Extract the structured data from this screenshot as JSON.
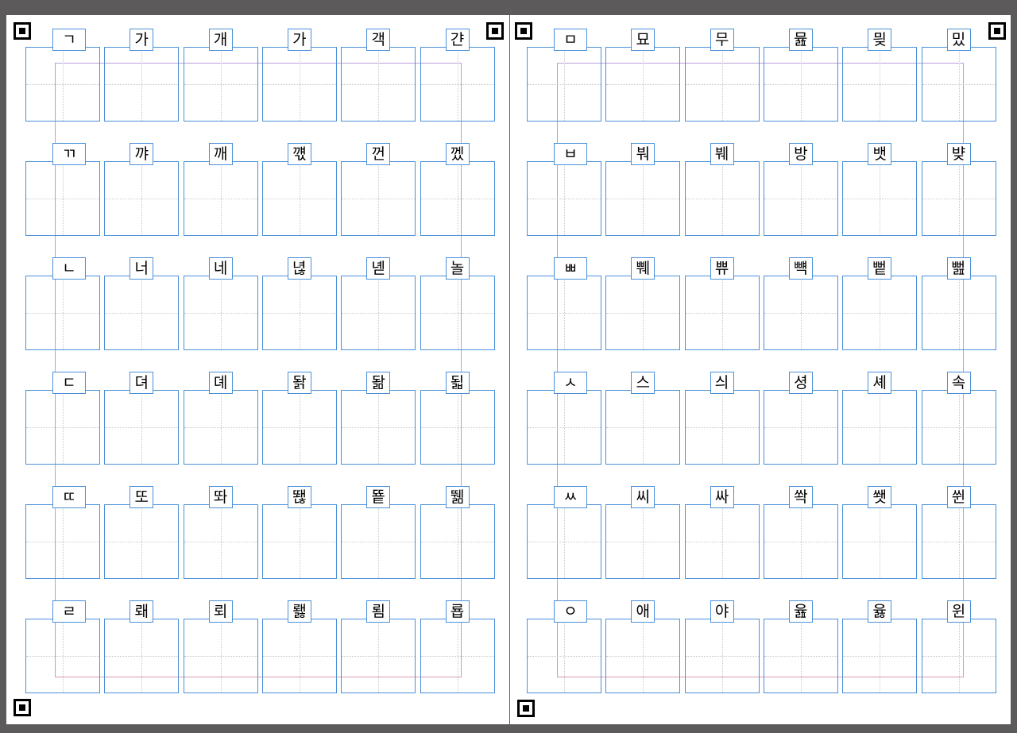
{
  "spread": {
    "pages": [
      {
        "id": "left",
        "rows": [
          [
            "ㄱ",
            "가",
            "개",
            "가",
            "객",
            "갼"
          ],
          [
            "ㄲ",
            "꺄",
            "깨",
            "꺣",
            "껀",
            "껬"
          ],
          [
            "ㄴ",
            "너",
            "네",
            "녆",
            "녣",
            "놀"
          ],
          [
            "ㄷ",
            "뎌",
            "뎨",
            "돩",
            "돪",
            "됣"
          ],
          [
            "ㄸ",
            "또",
            "똬",
            "뙎",
            "뚙",
            "뛞"
          ],
          [
            "ㄹ",
            "뢔",
            "뢰",
            "뢣",
            "룀",
            "룝"
          ]
        ]
      },
      {
        "id": "right",
        "rows": [
          [
            "ㅁ",
            "묘",
            "무",
            "뮲",
            "믲",
            "밌"
          ],
          [
            "ㅂ",
            "붜",
            "붸",
            "방",
            "뱃",
            "뱢"
          ],
          [
            "ㅃ",
            "쀄",
            "쀼",
            "뺵",
            "뻩",
            "뻞"
          ],
          [
            "ㅅ",
            "스",
            "싀",
            "셩",
            "셰",
            "속"
          ],
          [
            "ㅆ",
            "씨",
            "싸",
            "쏵",
            "쐣",
            "쒼"
          ],
          [
            "ㅇ",
            "애",
            "야",
            "윮",
            "윯",
            "윈"
          ]
        ]
      }
    ]
  },
  "colors": {
    "canvas": "#5d5a5b",
    "page": "#ffffff",
    "box_border": "#4a90d9",
    "guide": "#c9c9c9",
    "margin_guide": "#b8a0d8"
  }
}
